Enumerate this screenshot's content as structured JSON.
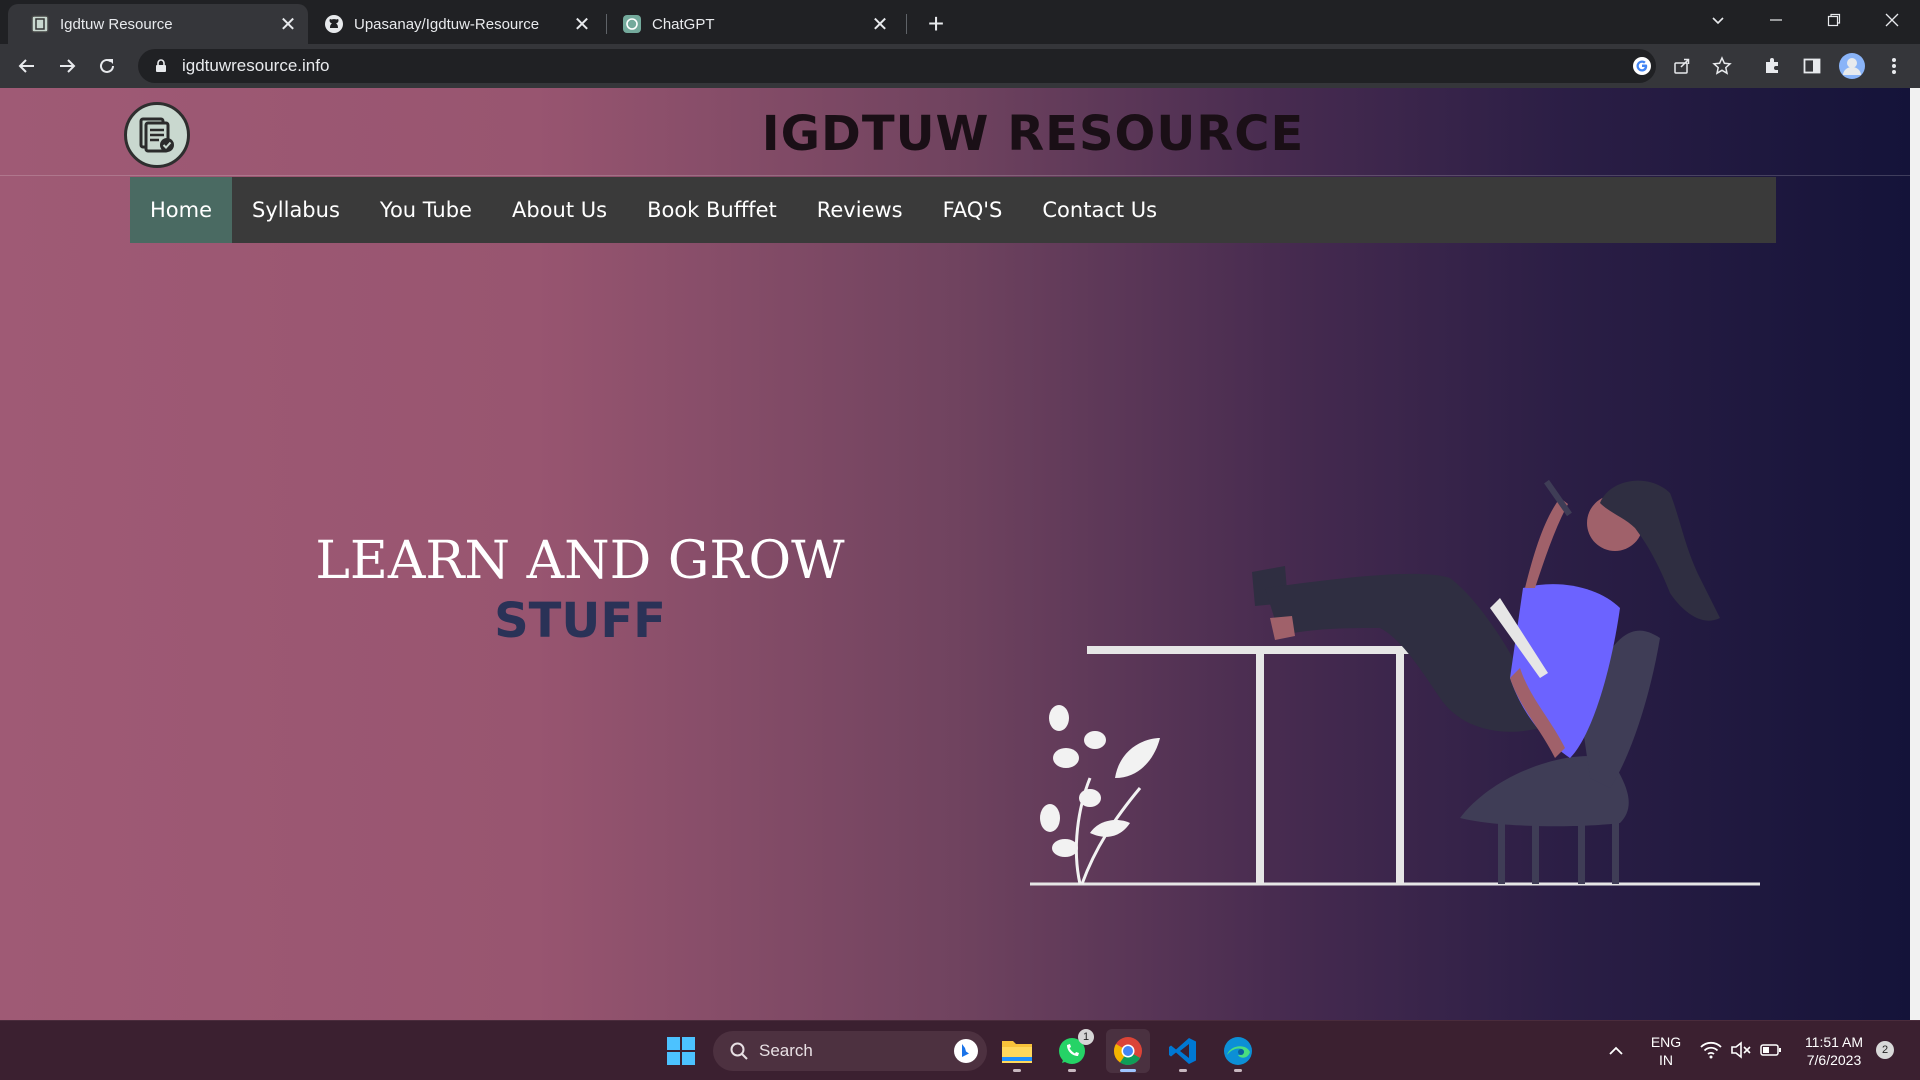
{
  "browser": {
    "tabs": [
      {
        "title": "Igdtuw Resource",
        "active": true
      },
      {
        "title": "Upasanay/Igdtuw-Resource",
        "active": false
      },
      {
        "title": "ChatGPT",
        "active": false
      }
    ],
    "url": "igdtuwresource.info"
  },
  "site": {
    "title": "IGDTUW RESOURCE",
    "nav": [
      "Home",
      "Syllabus",
      "You Tube",
      "About Us",
      "Book Bufffet",
      "Reviews",
      "FAQ'S",
      "Contact Us"
    ],
    "active_nav": "Home",
    "hero": {
      "line1": "LEARN AND GROW",
      "line2": "STUFF"
    }
  },
  "taskbar": {
    "search_placeholder": "Search",
    "whatsapp_badge": "1",
    "lang": "ENG",
    "region": "IN",
    "time": "11:51 AM",
    "date": "7/6/2023",
    "notifications": "2"
  },
  "colors": {
    "gradient_left": "#9f5a75",
    "gradient_right": "#141339",
    "nav_bg": "#3a3a3a",
    "nav_active": "#4a6a62",
    "hero_accent": "#2a3257",
    "illustration_shirt": "#6c63ff"
  }
}
